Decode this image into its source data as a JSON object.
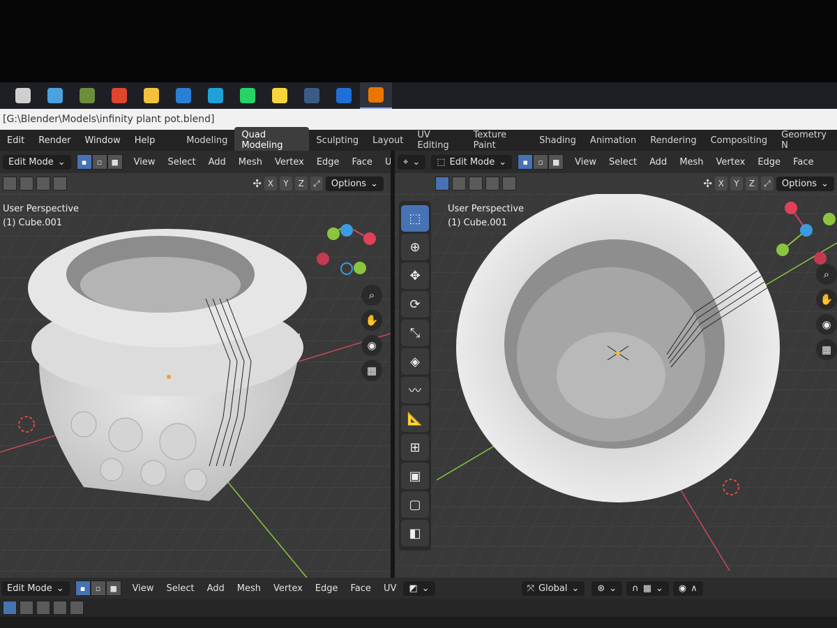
{
  "window_title": "[G:\\Blender\\Models\\infinity plant pot.blend]",
  "taskbar": {
    "icons": [
      {
        "name": "task-view-icon",
        "color": "#cfcfcf"
      },
      {
        "name": "computer-icon",
        "color": "#4aa3df"
      },
      {
        "name": "minecraft-icon",
        "color": "#6b8e3a"
      },
      {
        "name": "chrome-icon",
        "color": "#e0452d"
      },
      {
        "name": "file-explorer-icon",
        "color": "#f3c13a"
      },
      {
        "name": "mail-icon",
        "color": "#2a7fd4"
      },
      {
        "name": "edge-icon",
        "color": "#1fa1d8"
      },
      {
        "name": "whatsapp-icon",
        "color": "#25d366"
      },
      {
        "name": "sticky-notes-icon",
        "color": "#f6d43a"
      },
      {
        "name": "steam-icon",
        "color": "#3b5b86"
      },
      {
        "name": "media-app-icon",
        "color": "#1f6fd6"
      },
      {
        "name": "blender-icon",
        "color": "#ea7600"
      }
    ]
  },
  "menu": {
    "items": [
      "Edit",
      "Render",
      "Window",
      "Help"
    ],
    "workspaces": [
      "Modeling",
      "Quad Modeling",
      "Sculpting",
      "Layout",
      "UV Editing",
      "Texture Paint",
      "Shading",
      "Animation",
      "Rendering",
      "Compositing",
      "Geometry N"
    ],
    "active_workspace": "Quad Modeling"
  },
  "left": {
    "mode": "Edit Mode",
    "menus": [
      "View",
      "Select",
      "Add",
      "Mesh",
      "Vertex",
      "Edge",
      "Face",
      "U"
    ],
    "axes": [
      "X",
      "Y",
      "Z"
    ],
    "options": "Options",
    "perspective": "User Perspective",
    "object": "(1) Cube.001"
  },
  "right": {
    "mode": "Edit Mode",
    "menus": [
      "View",
      "Select",
      "Add",
      "Mesh",
      "Vertex",
      "Edge",
      "Face"
    ],
    "axes": [
      "X",
      "Y",
      "Z"
    ],
    "options": "Options",
    "perspective": "User Perspective",
    "object": "(1) Cube.001"
  },
  "footer": {
    "mode": "Edit Mode",
    "menus": [
      "View",
      "Select",
      "Add",
      "Mesh",
      "Vertex",
      "Edge",
      "Face",
      "UV"
    ],
    "orientation": "Global"
  },
  "colors": {
    "accent": "#4772b3",
    "x_axis": "#e0415a",
    "y_axis": "#8bc53f",
    "z_axis": "#3a9be0"
  }
}
